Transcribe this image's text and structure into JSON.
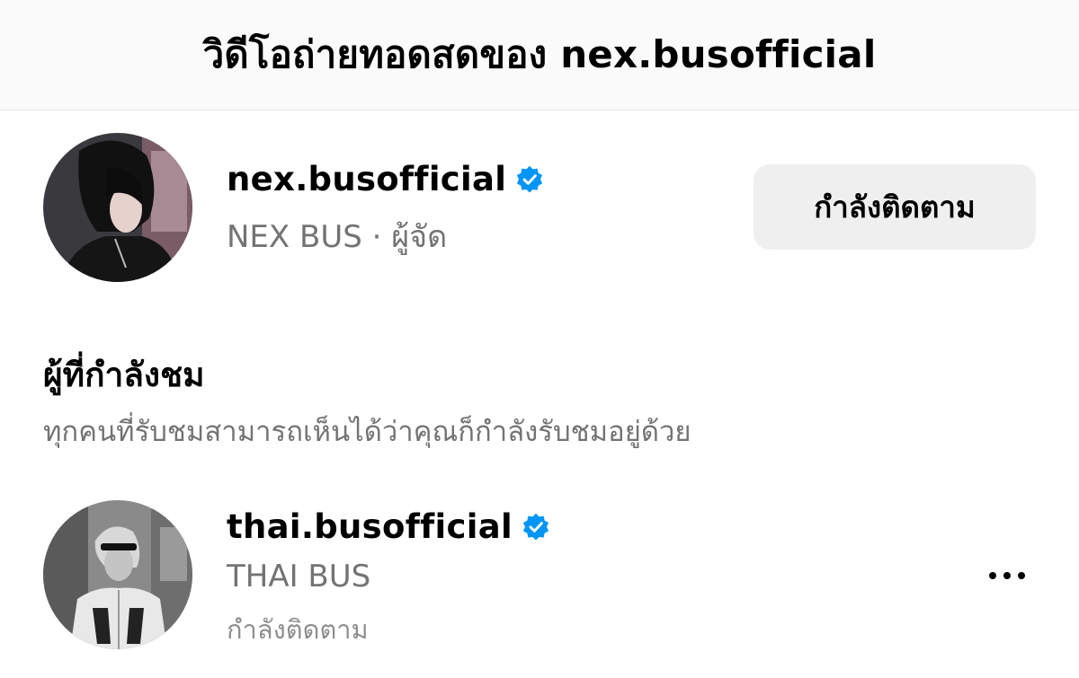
{
  "header": {
    "title": "วิดีโอถ่ายทอดสดของ nex.busofficial"
  },
  "host": {
    "username": "nex.busofficial",
    "display_name": "NEX BUS · ผู้จัด",
    "follow_button": "กำลังติดตาม",
    "verified_icon": "verified-badge-icon"
  },
  "viewers_section": {
    "title": "ผู้ที่กำลังชม",
    "description": "ทุกคนที่รับชมสามารถเห็นได้ว่าคุณก็กำลังรับชมอยู่ด้วย"
  },
  "viewers": [
    {
      "username": "thai.busofficial",
      "display_name": "THAI BUS",
      "status": "กำลังติดตาม",
      "more_icon": "more-options-icon"
    }
  ],
  "colors": {
    "verified": "#0095f6",
    "secondary_text": "#737373",
    "button_bg": "#efefef",
    "header_bg": "#fafafa"
  }
}
